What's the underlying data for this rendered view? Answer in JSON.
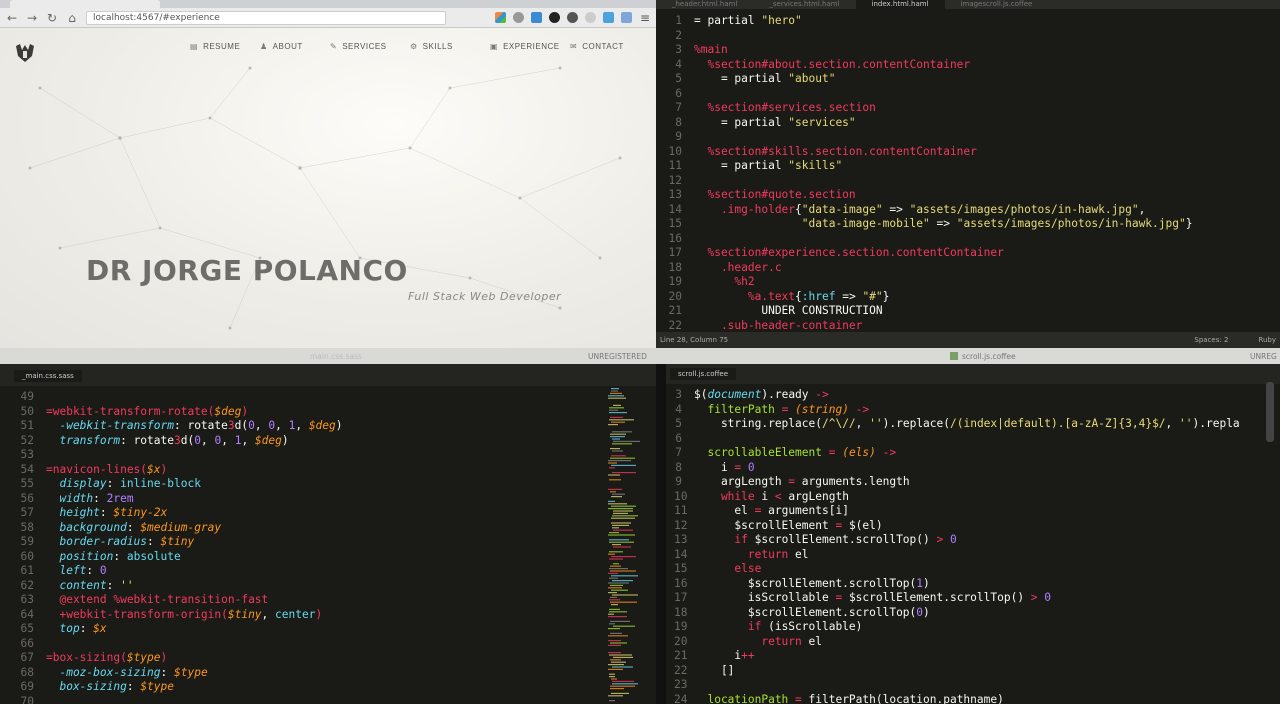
{
  "browser": {
    "url": "localhost:4567/#experience",
    "nav": [
      {
        "label": "RESUME",
        "icon": "document-icon"
      },
      {
        "label": "ABOUT",
        "icon": "person-icon"
      },
      {
        "label": "SERVICES",
        "icon": "wrench-icon"
      },
      {
        "label": "SKILLS",
        "icon": "gears-icon"
      },
      {
        "label": "EXPERIENCE",
        "icon": "briefcase-icon"
      },
      {
        "label": "CONTACT",
        "icon": "envelope-icon"
      }
    ],
    "hero_name": "DR JORGE POLANCO",
    "hero_role": "Full Stack Web Developer"
  },
  "haml_editor": {
    "tabs": [
      "_header.html.haml",
      "_services.html.haml",
      "index.html.haml",
      "imagescroll.js.coffee"
    ],
    "active_tab": 2,
    "status_left": "Line 28, Column 75",
    "status_spaces": "Spaces: 2",
    "status_syntax": "Ruby"
  },
  "band": {
    "sass_title": "main.css.sass",
    "unregistered": "UNREGISTERED",
    "coffee_title": "scroll.js.coffee",
    "unregistered2": "UNREG"
  },
  "sass_editor": {
    "tab": "_main.css.sass"
  },
  "coffee_editor": {
    "tab": "scroll.js.coffee"
  },
  "colors": {
    "bg": "#1a1a17",
    "pink": "#f23a5e",
    "yellow": "#e6db74",
    "green": "#a6e22e",
    "orange": "#fd971f",
    "blue": "#66d9ef"
  },
  "code": {
    "haml": [
      {
        "n": "1",
        "t": [
          [
            "= partial ",
            "w"
          ],
          [
            "\"hero\"",
            "y"
          ]
        ]
      },
      {
        "n": "2",
        "t": []
      },
      {
        "n": "3",
        "t": [
          [
            "%main",
            "r"
          ]
        ]
      },
      {
        "n": "4",
        "t": [
          [
            "  %section#about.section.contentContainer",
            "r"
          ]
        ]
      },
      {
        "n": "5",
        "t": [
          [
            "    = partial ",
            "w"
          ],
          [
            "\"about\"",
            "y"
          ]
        ]
      },
      {
        "n": "6",
        "t": []
      },
      {
        "n": "7",
        "t": [
          [
            "  %section#services.section",
            "r"
          ]
        ]
      },
      {
        "n": "8",
        "t": [
          [
            "    = partial ",
            "w"
          ],
          [
            "\"services\"",
            "y"
          ]
        ]
      },
      {
        "n": "9",
        "t": []
      },
      {
        "n": "10",
        "t": [
          [
            "  %section#skills.section.contentContainer",
            "r"
          ]
        ]
      },
      {
        "n": "11",
        "t": [
          [
            "    = partial ",
            "w"
          ],
          [
            "\"skills\"",
            "y"
          ]
        ]
      },
      {
        "n": "12",
        "t": []
      },
      {
        "n": "13",
        "t": [
          [
            "  %section#quote.section",
            "r"
          ]
        ]
      },
      {
        "n": "14",
        "t": [
          [
            "    .img-holder",
            "r"
          ],
          [
            "{",
            "w"
          ],
          [
            "\"data-image\"",
            "y"
          ],
          [
            " => ",
            "w"
          ],
          [
            "\"assets/images/photos/in-hawk.jpg\"",
            "y"
          ],
          [
            ",",
            "w"
          ]
        ]
      },
      {
        "n": "15",
        "t": [
          [
            "                ",
            "w"
          ],
          [
            "\"data-image-mobile\"",
            "y"
          ],
          [
            " => ",
            "w"
          ],
          [
            "\"assets/images/photos/in-hawk.jpg\"",
            "y"
          ],
          [
            "}",
            "w"
          ]
        ]
      },
      {
        "n": "16",
        "t": []
      },
      {
        "n": "17",
        "t": [
          [
            "  %section#experience.section.contentContainer",
            "r"
          ]
        ]
      },
      {
        "n": "18",
        "t": [
          [
            "    .header.c",
            "r"
          ]
        ]
      },
      {
        "n": "19",
        "t": [
          [
            "      %h2",
            "r"
          ]
        ]
      },
      {
        "n": "20",
        "t": [
          [
            "        %a.text",
            "r"
          ],
          [
            "{",
            "w"
          ],
          [
            ":href",
            "b"
          ],
          [
            " => ",
            "w"
          ],
          [
            "\"#\"",
            "y"
          ],
          [
            "}",
            "w"
          ]
        ]
      },
      {
        "n": "21",
        "t": [
          [
            "          UNDER CONSTRUCTION",
            "w"
          ]
        ]
      },
      {
        "n": "22",
        "t": [
          [
            "    .sub-header-container",
            "r"
          ]
        ]
      }
    ],
    "sass": [
      {
        "n": "49",
        "t": []
      },
      {
        "n": "50",
        "t": [
          [
            "=webkit-transform-rotate(",
            "r"
          ],
          [
            "$deg",
            "oi"
          ],
          [
            ")",
            "r"
          ]
        ]
      },
      {
        "n": "51",
        "t": [
          [
            "  -webkit-transform",
            "bi"
          ],
          [
            ": rotate",
            "w"
          ],
          [
            "3",
            "r"
          ],
          [
            "d(",
            "w"
          ],
          [
            "0",
            "p"
          ],
          [
            ", ",
            "w"
          ],
          [
            "0",
            "p"
          ],
          [
            ", ",
            "w"
          ],
          [
            "1",
            "p"
          ],
          [
            ", ",
            "w"
          ],
          [
            "$deg",
            "oi"
          ],
          [
            ")",
            "w"
          ]
        ]
      },
      {
        "n": "52",
        "t": [
          [
            "  transform",
            "bi"
          ],
          [
            ": rotate",
            "w"
          ],
          [
            "3",
            "r"
          ],
          [
            "d(",
            "w"
          ],
          [
            "0",
            "p"
          ],
          [
            ", ",
            "w"
          ],
          [
            "0",
            "p"
          ],
          [
            ", ",
            "w"
          ],
          [
            "1",
            "p"
          ],
          [
            ", ",
            "w"
          ],
          [
            "$deg",
            "oi"
          ],
          [
            ")",
            "w"
          ]
        ]
      },
      {
        "n": "53",
        "t": []
      },
      {
        "n": "54",
        "t": [
          [
            "=navicon-lines(",
            "r"
          ],
          [
            "$x",
            "oi"
          ],
          [
            ")",
            "r"
          ]
        ]
      },
      {
        "n": "55",
        "t": [
          [
            "  display",
            "bi"
          ],
          [
            ": ",
            "w"
          ],
          [
            "inline-block",
            "b"
          ]
        ]
      },
      {
        "n": "56",
        "t": [
          [
            "  width",
            "bi"
          ],
          [
            ": ",
            "w"
          ],
          [
            "2rem",
            "p"
          ]
        ]
      },
      {
        "n": "57",
        "t": [
          [
            "  height",
            "bi"
          ],
          [
            ": ",
            "w"
          ],
          [
            "$tiny-2x",
            "oi"
          ]
        ]
      },
      {
        "n": "58",
        "t": [
          [
            "  background",
            "bi"
          ],
          [
            ": ",
            "w"
          ],
          [
            "$medium-gray",
            "oi"
          ]
        ]
      },
      {
        "n": "59",
        "t": [
          [
            "  border-radius",
            "bi"
          ],
          [
            ": ",
            "w"
          ],
          [
            "$tiny",
            "oi"
          ]
        ]
      },
      {
        "n": "60",
        "t": [
          [
            "  position",
            "bi"
          ],
          [
            ": ",
            "w"
          ],
          [
            "absolute",
            "b"
          ]
        ]
      },
      {
        "n": "61",
        "t": [
          [
            "  left",
            "bi"
          ],
          [
            ": ",
            "w"
          ],
          [
            "0",
            "p"
          ]
        ]
      },
      {
        "n": "62",
        "t": [
          [
            "  content",
            "bi"
          ],
          [
            ": ",
            "w"
          ],
          [
            "''",
            "y"
          ]
        ]
      },
      {
        "n": "63",
        "t": [
          [
            "  @extend %webkit-transition-fast",
            "r"
          ]
        ]
      },
      {
        "n": "64",
        "t": [
          [
            "  +webkit-transform-origin(",
            "r"
          ],
          [
            "$tiny",
            "oi"
          ],
          [
            ", ",
            "w"
          ],
          [
            "center",
            "b"
          ],
          [
            ")",
            "r"
          ]
        ]
      },
      {
        "n": "65",
        "t": [
          [
            "  top",
            "bi"
          ],
          [
            ": ",
            "w"
          ],
          [
            "$x",
            "oi"
          ]
        ]
      },
      {
        "n": "66",
        "t": []
      },
      {
        "n": "67",
        "t": [
          [
            "=box-sizing(",
            "r"
          ],
          [
            "$type",
            "oi"
          ],
          [
            ")",
            "r"
          ]
        ]
      },
      {
        "n": "68",
        "t": [
          [
            "  -moz-box-sizing",
            "bi"
          ],
          [
            ": ",
            "w"
          ],
          [
            "$type",
            "oi"
          ]
        ]
      },
      {
        "n": "69",
        "t": [
          [
            "  box-sizing",
            "bi"
          ],
          [
            ": ",
            "w"
          ],
          [
            "$type",
            "oi"
          ]
        ]
      },
      {
        "n": "70",
        "t": []
      }
    ],
    "coffee": [
      {
        "n": "3",
        "t": [
          [
            "$(",
            "w"
          ],
          [
            "document",
            "bi"
          ],
          [
            ").ready ",
            "w"
          ],
          [
            "->",
            "r"
          ]
        ]
      },
      {
        "n": "4",
        "t": [
          [
            "  filterPath",
            "g"
          ],
          [
            " = ",
            "r"
          ],
          [
            "(string)",
            "oi"
          ],
          [
            " ->",
            "r"
          ]
        ]
      },
      {
        "n": "5",
        "t": [
          [
            "    string.replace(",
            "w"
          ],
          [
            "/^\\//",
            "y"
          ],
          [
            ", ",
            "w"
          ],
          [
            "''",
            "y"
          ],
          [
            ").replace(",
            "w"
          ],
          [
            "/(index|default).[a-zA-Z]{3,4}$/",
            "y"
          ],
          [
            ", ",
            "w"
          ],
          [
            "''",
            "y"
          ],
          [
            ").repla",
            "w"
          ]
        ]
      },
      {
        "n": "6",
        "t": []
      },
      {
        "n": "7",
        "t": [
          [
            "  scrollableElement",
            "g"
          ],
          [
            " = ",
            "r"
          ],
          [
            "(els)",
            "oi"
          ],
          [
            " ->",
            "r"
          ]
        ]
      },
      {
        "n": "8",
        "t": [
          [
            "    i",
            "w"
          ],
          [
            " = ",
            "r"
          ],
          [
            "0",
            "p"
          ]
        ]
      },
      {
        "n": "9",
        "t": [
          [
            "    argLength",
            "w"
          ],
          [
            " = ",
            "r"
          ],
          [
            "arguments.length",
            "w"
          ]
        ]
      },
      {
        "n": "10",
        "t": [
          [
            "    while",
            "r"
          ],
          [
            " i ",
            "w"
          ],
          [
            "<",
            "r"
          ],
          [
            " argLength",
            "w"
          ]
        ]
      },
      {
        "n": "11",
        "t": [
          [
            "      el",
            "w"
          ],
          [
            " = ",
            "r"
          ],
          [
            "arguments[i]",
            "w"
          ]
        ]
      },
      {
        "n": "12",
        "t": [
          [
            "      $scrollElement",
            "w"
          ],
          [
            " = ",
            "r"
          ],
          [
            "$(el)",
            "w"
          ]
        ]
      },
      {
        "n": "13",
        "t": [
          [
            "      if",
            "r"
          ],
          [
            " $scrollElement.scrollTop() ",
            "w"
          ],
          [
            ">",
            "r"
          ],
          [
            " 0",
            "p"
          ]
        ]
      },
      {
        "n": "14",
        "t": [
          [
            "        return",
            "r"
          ],
          [
            " el",
            "w"
          ]
        ]
      },
      {
        "n": "15",
        "t": [
          [
            "      else",
            "r"
          ]
        ]
      },
      {
        "n": "16",
        "t": [
          [
            "        $scrollElement.scrollTop(",
            "w"
          ],
          [
            "1",
            "p"
          ],
          [
            ")",
            "w"
          ]
        ]
      },
      {
        "n": "17",
        "t": [
          [
            "        isScrollable",
            "w"
          ],
          [
            " = ",
            "r"
          ],
          [
            "$scrollElement.scrollTop() ",
            "w"
          ],
          [
            ">",
            "r"
          ],
          [
            " 0",
            "p"
          ]
        ]
      },
      {
        "n": "18",
        "t": [
          [
            "        $scrollElement.scrollTop(",
            "w"
          ],
          [
            "0",
            "p"
          ],
          [
            ")",
            "w"
          ]
        ]
      },
      {
        "n": "19",
        "t": [
          [
            "        if",
            "r"
          ],
          [
            " (isScrollable)",
            "w"
          ]
        ]
      },
      {
        "n": "20",
        "t": [
          [
            "          return",
            "r"
          ],
          [
            " el",
            "w"
          ]
        ]
      },
      {
        "n": "21",
        "t": [
          [
            "      i",
            "w"
          ],
          [
            "++",
            "r"
          ]
        ]
      },
      {
        "n": "22",
        "t": [
          [
            "    []",
            "w"
          ]
        ]
      },
      {
        "n": "23",
        "t": []
      },
      {
        "n": "24",
        "t": [
          [
            "  locationPath",
            "g"
          ],
          [
            " = ",
            "r"
          ],
          [
            "filterPath(location.pathname)",
            "w"
          ]
        ]
      }
    ]
  }
}
